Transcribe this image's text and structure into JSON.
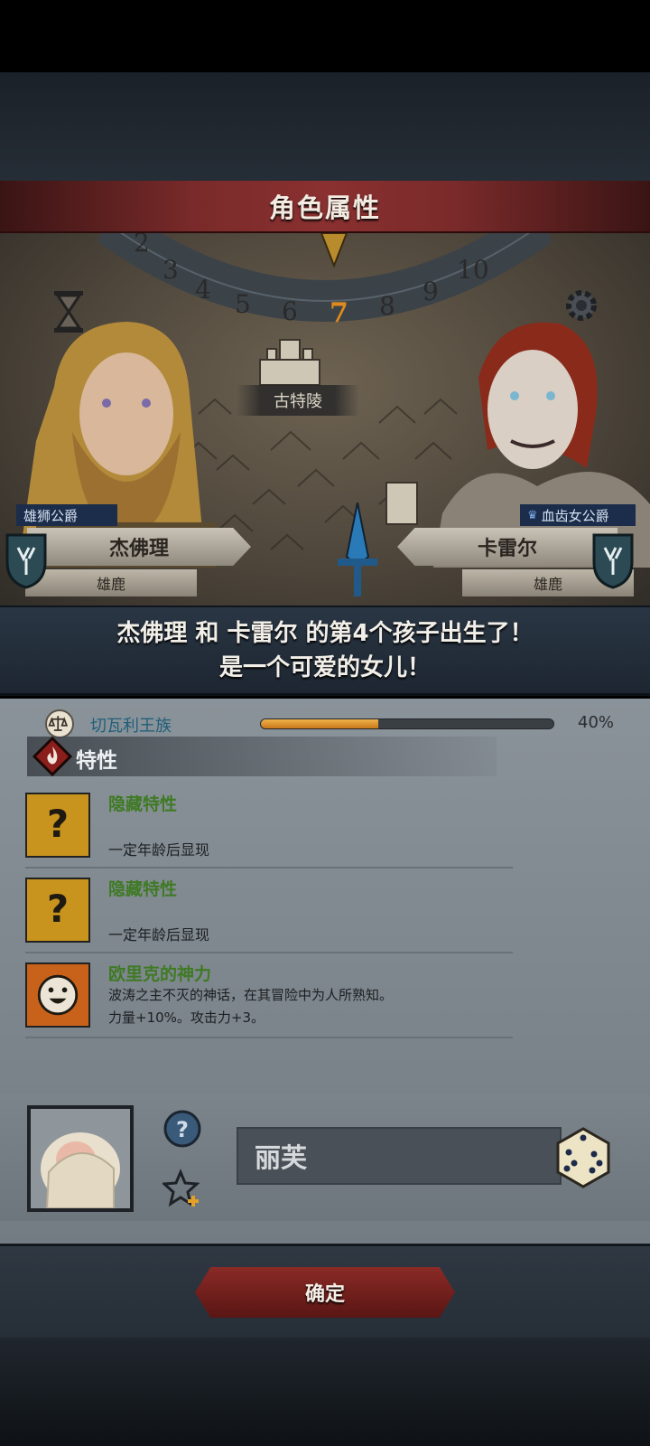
{
  "header": {
    "title": "角色属性"
  },
  "scene": {
    "dial_numbers": [
      "2",
      "3",
      "4",
      "5",
      "6",
      "7",
      "8",
      "9",
      "10"
    ],
    "current_turn": "7",
    "city_label": "古特陵"
  },
  "father": {
    "title": "雄狮公爵",
    "name": "杰佛理",
    "house": "雄鹿"
  },
  "mother": {
    "title": "血齿女公爵",
    "name": "卡雷尔",
    "house": "雄鹿"
  },
  "announcement": {
    "line1": "杰佛理 和 卡雷尔 的第4个孩子出生了！",
    "line2": "是一个可爱的女儿！"
  },
  "dynasty": {
    "name": "切瓦利王族",
    "progress": 0.4,
    "percent_label": "40%"
  },
  "traits": {
    "header": "特性",
    "items": [
      {
        "name": "隐藏特性",
        "desc": "一定年龄后显现",
        "icon": "question-mark-icon"
      },
      {
        "name": "隐藏特性",
        "desc": "一定年龄后显现",
        "icon": "question-mark-icon"
      },
      {
        "name": "欧里克的神力",
        "desc_line1": "波涛之主不灭的神话，在其冒险中为人所熟知。",
        "desc_line2": "力量+10%。攻击力+3。",
        "icon": "smiley-face-icon"
      }
    ]
  },
  "child": {
    "name": "丽芙"
  },
  "footer": {
    "confirm_label": "确定"
  },
  "colors": {
    "accent_red": "#8a2a26",
    "trait_green": "#3f7a24",
    "dynasty_orange": "#e0961e"
  }
}
